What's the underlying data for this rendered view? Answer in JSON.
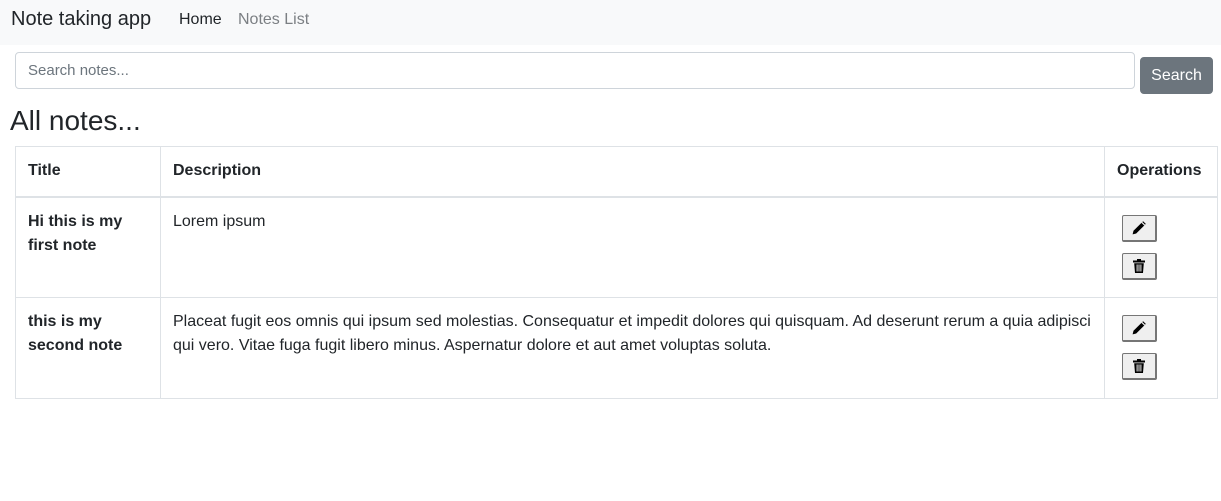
{
  "navbar": {
    "brand": "Note taking app",
    "links": [
      {
        "label": "Home",
        "active": true
      },
      {
        "label": "Notes List",
        "active": false
      }
    ]
  },
  "search": {
    "placeholder": "Search notes...",
    "value": "",
    "button_label": "Search"
  },
  "page": {
    "title": "All notes..."
  },
  "table": {
    "headers": [
      "Title",
      "Description",
      "Operations"
    ],
    "rows": [
      {
        "title": "Hi this is my first note",
        "description": "Lorem ipsum",
        "operations": [
          "pencil-icon",
          "trash-icon"
        ]
      },
      {
        "title": "this is my second note",
        "description": "Placeat fugit eos omnis qui ipsum sed molestias. Consequatur et impedit dolores qui quisquam. Ad deserunt rerum a quia adipisci qui vero. Vitae fuga fugit libero minus. Aspernatur dolore et aut amet voluptas soluta.",
        "operations": [
          "pencil-icon",
          "trash-icon"
        ]
      }
    ]
  },
  "colors": {
    "navbar_bg": "#f8f9fa",
    "search_button_bg": "#6c757d",
    "muted_link": "#7b7f83",
    "border": "#dee2e6"
  }
}
